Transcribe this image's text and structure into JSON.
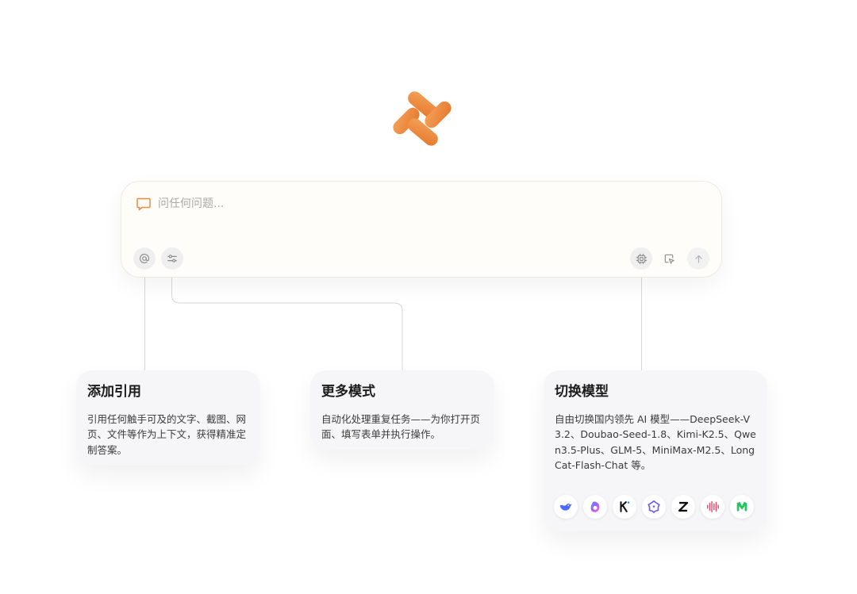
{
  "input": {
    "placeholder": "问任何问题..."
  },
  "toolbar": {
    "left": [
      "mention-icon",
      "sliders-icon"
    ],
    "right": [
      "chip-icon",
      "select-cursor-icon",
      "arrow-up-icon"
    ]
  },
  "cards": [
    {
      "title": "添加引用",
      "description": "引用任何触手可及的文字、截图、网页、文件等作为上下文，获得精准定制答案。"
    },
    {
      "title": "更多模式",
      "description": "自动化处理重复任务——为你打开页面、填写表单并执行操作。"
    },
    {
      "title": "切换模型",
      "description": "自由切换国内领先 AI 模型——DeepSeek-V3.2、Doubao-Seed-1.8、Kimi-K2.5、Qwen3.5-Plus、GLM-5、MiniMax-M2.5、LongCat-Flash-Chat 等。"
    }
  ],
  "model_icons": [
    "deepseek-icon",
    "doubao-icon",
    "kimi-icon",
    "qwen-icon",
    "zhipu-icon",
    "minimax-icon",
    "longcat-icon"
  ],
  "colors": {
    "brand": "#ee8a3c",
    "brand_dark": "#e07528",
    "card_bg": "#f6f6f8",
    "input_bg": "#fffdf9"
  }
}
